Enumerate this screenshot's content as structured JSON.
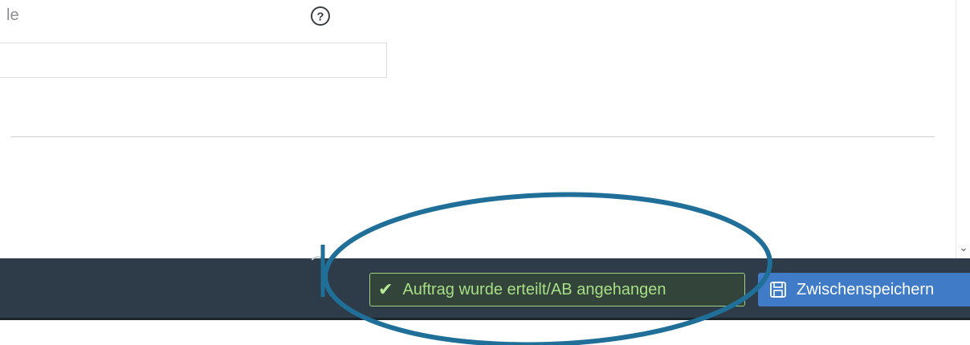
{
  "form": {
    "field_label": "le",
    "input_value": "",
    "help_icon": "question-circle-icon"
  },
  "footer": {
    "status_message": "Auftrag wurde erteilt/AB angehangen",
    "status_icon": "checkmark-icon",
    "save_label": "Zwischenspeichern",
    "save_icon": "floppy-disk-icon"
  },
  "colors": {
    "footer_bg": "#2e3b48",
    "status_text": "#a7df86",
    "save_button_bg": "#3f7bc6",
    "annotation": "#1f6f99"
  }
}
